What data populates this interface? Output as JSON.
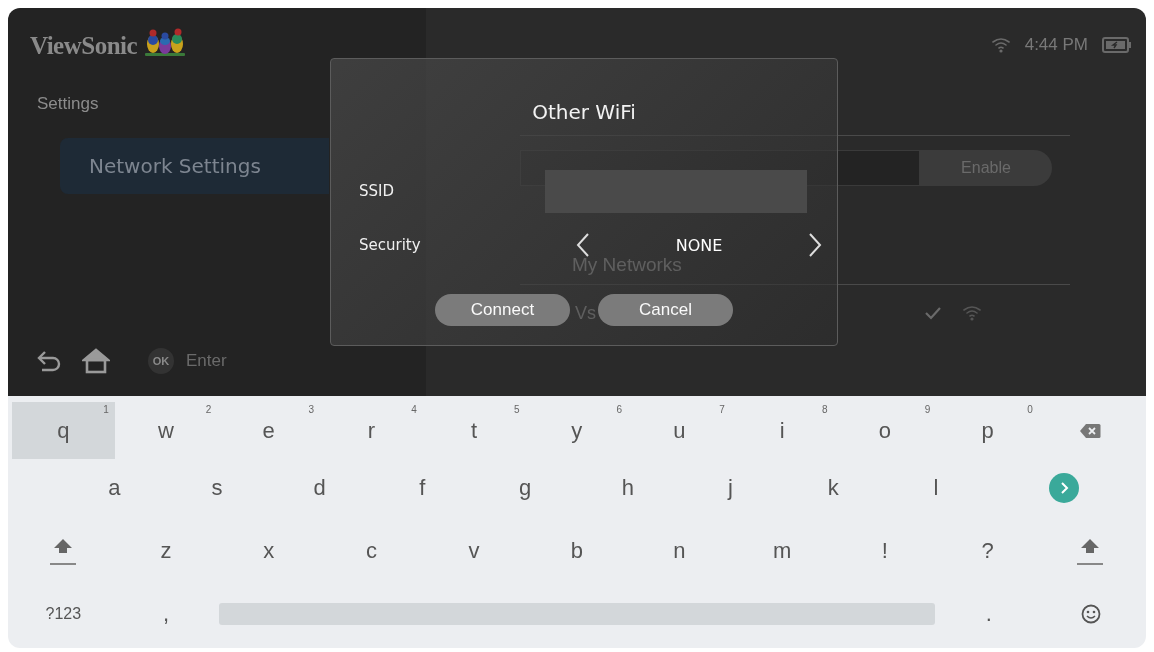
{
  "header": {
    "logo": "ViewSonic",
    "time": "4:44 PM"
  },
  "sidebar": {
    "title": "Settings",
    "items": [
      {
        "label": "Network Settings",
        "selected": true
      }
    ]
  },
  "footer": {
    "ok_badge": "OK",
    "hint": "Enter"
  },
  "network_panel": {
    "button": "Enable",
    "section": "My Networks",
    "networks": [
      {
        "name": "Vs",
        "connected": true
      }
    ]
  },
  "dialog": {
    "title": "Other WiFi",
    "fields": [
      {
        "kind": "input",
        "label": "SSID"
      },
      {
        "kind": "selector",
        "label": "Security",
        "value": "NONE"
      }
    ],
    "buttons": [
      "Connect",
      "Cancel"
    ]
  },
  "keyboard": {
    "rows": [
      [
        {
          "kind": "char",
          "label": "q",
          "hint": "1",
          "selected": true
        },
        {
          "kind": "char",
          "label": "w",
          "hint": "2",
          "selected": false
        },
        {
          "kind": "char",
          "label": "e",
          "hint": "3",
          "selected": false
        },
        {
          "kind": "char",
          "label": "r",
          "hint": "4",
          "selected": false
        },
        {
          "kind": "char",
          "label": "t",
          "hint": "5",
          "selected": false
        },
        {
          "kind": "char",
          "label": "y",
          "hint": "6",
          "selected": false
        },
        {
          "kind": "char",
          "label": "u",
          "hint": "7",
          "selected": false
        },
        {
          "kind": "char",
          "label": "i",
          "hint": "8",
          "selected": false
        },
        {
          "kind": "char",
          "label": "o",
          "hint": "9",
          "selected": false
        },
        {
          "kind": "char",
          "label": "p",
          "hint": "0",
          "selected": false
        },
        {
          "kind": "backspace",
          "selected": false
        }
      ],
      [
        {
          "kind": "char",
          "label": "a",
          "selected": false
        },
        {
          "kind": "char",
          "label": "s",
          "selected": false
        },
        {
          "kind": "char",
          "label": "d",
          "selected": false
        },
        {
          "kind": "char",
          "label": "f",
          "selected": false
        },
        {
          "kind": "char",
          "label": "g",
          "selected": false
        },
        {
          "kind": "char",
          "label": "h",
          "selected": false
        },
        {
          "kind": "char",
          "label": "j",
          "selected": false
        },
        {
          "kind": "char",
          "label": "k",
          "selected": false
        },
        {
          "kind": "char",
          "label": "l",
          "selected": false
        },
        {
          "kind": "go",
          "selected": false
        }
      ],
      [
        {
          "kind": "shift",
          "selected": false
        },
        {
          "kind": "char",
          "label": "z",
          "selected": false
        },
        {
          "kind": "char",
          "label": "x",
          "selected": false
        },
        {
          "kind": "char",
          "label": "c",
          "selected": false
        },
        {
          "kind": "char",
          "label": "v",
          "selected": false
        },
        {
          "kind": "char",
          "label": "b",
          "selected": false
        },
        {
          "kind": "char",
          "label": "n",
          "selected": false
        },
        {
          "kind": "char",
          "label": "m",
          "selected": false
        },
        {
          "kind": "char",
          "label": "!",
          "selected": false
        },
        {
          "kind": "char",
          "label": "?",
          "selected": false
        },
        {
          "kind": "shift",
          "selected": false
        }
      ]
    ],
    "bottom_row": {
      "symbols_key": "?123",
      "comma_key": ",",
      "period_key": "."
    }
  }
}
